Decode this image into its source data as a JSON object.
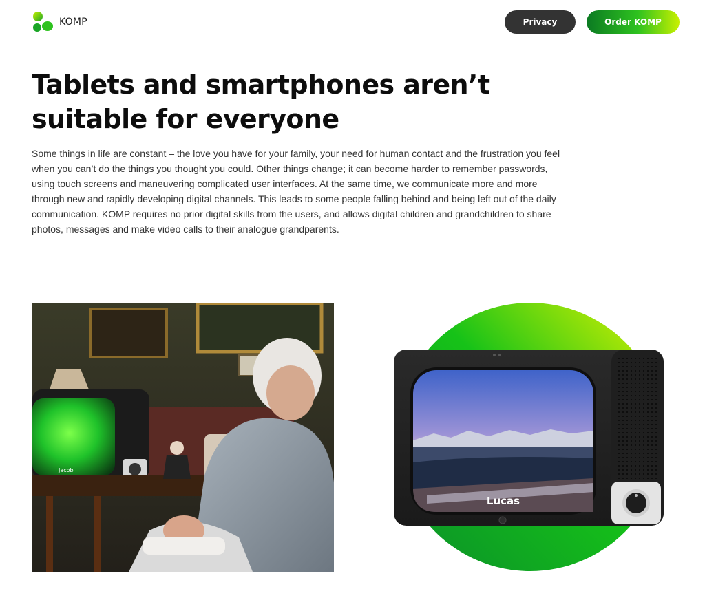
{
  "header": {
    "brand": "KOMP",
    "logo_icon": "komp-logo-icon",
    "privacy_label": "Privacy",
    "order_label": "Order KOMP"
  },
  "main": {
    "headline": "Tablets and smartphones aren’t suitable for everyone",
    "intro": "Some things in life are constant – the love you have for your family, your need for human contact and the frustration you feel when you can’t do the things you thought you could. Other things change; it can become harder to remember passwords, using touch screens and maneuvering complicated user interfaces. At the same time, we communicate more and more through new and rapidly developing digital channels. This leads to some people falling behind and being left out of the daily communication. KOMP requires no prior digital skills from the users, and allows digital children and grandchildren to share photos, messages and make video calls to their analogue grandparents."
  },
  "photo": {
    "screen_name": "Jacob"
  },
  "device": {
    "screen_name": "Lucas"
  },
  "colors": {
    "green_dark": "#0b7a22",
    "green_mid": "#2ec21f",
    "green_light": "#c8f000",
    "button_dark": "#333333"
  }
}
